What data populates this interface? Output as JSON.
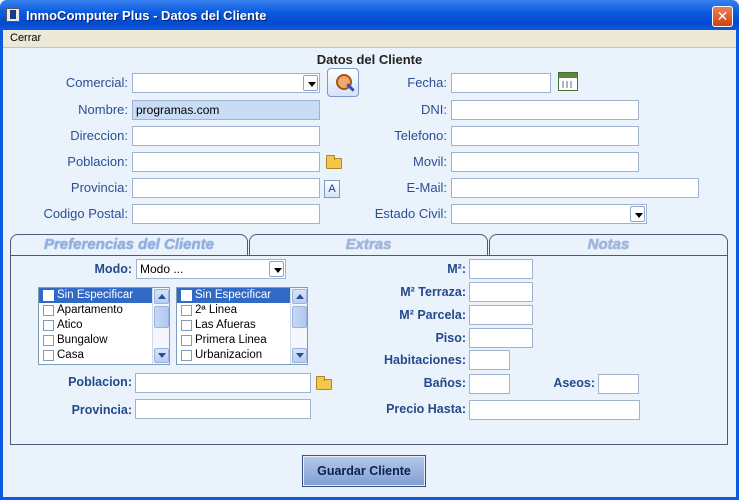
{
  "window": {
    "title": "InmoComputer Plus - Datos del Cliente"
  },
  "menu": {
    "items": [
      "Cerrar"
    ]
  },
  "section_title": "Datos del Cliente",
  "left_fields": {
    "comercial": {
      "label": "Comercial:",
      "value": ""
    },
    "nombre": {
      "label": "Nombre:",
      "value": "programas.com"
    },
    "direccion": {
      "label": "Direccion:",
      "value": ""
    },
    "poblacion": {
      "label": "Poblacion:",
      "value": ""
    },
    "provincia": {
      "label": "Provincia:",
      "value": "",
      "button_label": "A"
    },
    "codigo_postal": {
      "label": "Codigo Postal:",
      "value": ""
    }
  },
  "right_fields": {
    "fecha": {
      "label": "Fecha:",
      "value": ""
    },
    "dni": {
      "label": "DNI:",
      "value": ""
    },
    "telefono": {
      "label": "Telefono:",
      "value": ""
    },
    "movil": {
      "label": "Movil:",
      "value": ""
    },
    "email": {
      "label": "E-Mail:",
      "value": ""
    },
    "estado_civil": {
      "label": "Estado Civil:",
      "value": ""
    }
  },
  "tabs": [
    {
      "label": "Preferencias del Cliente",
      "active": true
    },
    {
      "label": "Extras",
      "active": false
    },
    {
      "label": "Notas",
      "active": false
    }
  ],
  "prefs": {
    "modo": {
      "label": "Modo:",
      "value": "Modo ..."
    },
    "list1": [
      "Sin Especificar",
      "Apartamento",
      "Atico",
      "Bungalow",
      "Casa"
    ],
    "list2": [
      "Sin Especificar",
      "2ª Linea",
      "Las Afueras",
      "Primera Linea",
      "Urbanizacion"
    ],
    "poblacion": {
      "label": "Poblacion:",
      "value": ""
    },
    "provincia": {
      "label": "Provincia:",
      "value": ""
    },
    "m2": {
      "label": "M²:",
      "value": ""
    },
    "m2_terraza": {
      "label": "M² Terraza:",
      "value": ""
    },
    "m2_parcela": {
      "label": "M² Parcela:",
      "value": ""
    },
    "piso": {
      "label": "Piso:",
      "value": ""
    },
    "habitaciones": {
      "label": "Habitaciones:",
      "value": ""
    },
    "banos": {
      "label": "Baños:",
      "value": ""
    },
    "aseos": {
      "label": "Aseos:",
      "value": ""
    },
    "precio_hasta": {
      "label": "Precio Hasta:",
      "value": ""
    }
  },
  "save_button": "Guardar Cliente"
}
